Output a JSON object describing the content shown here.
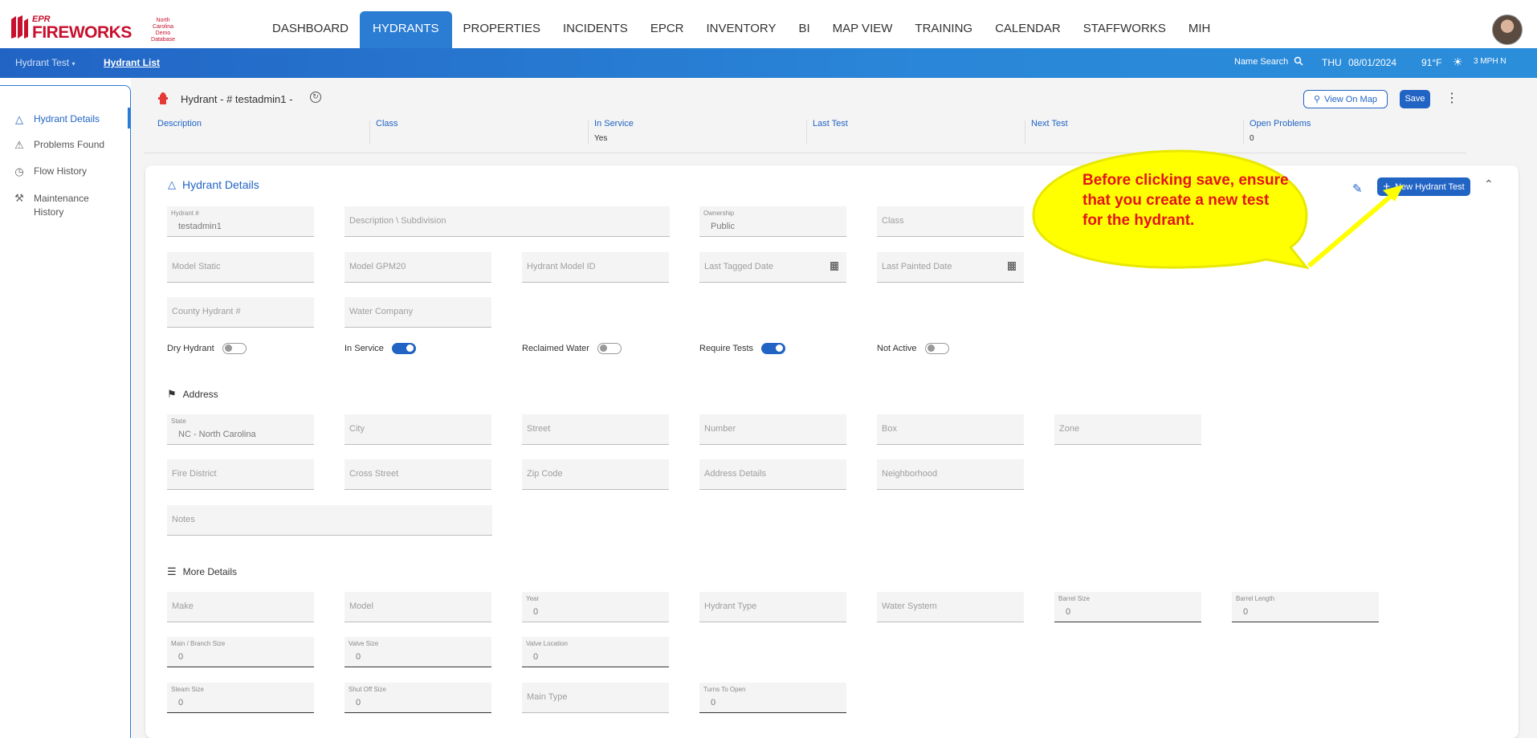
{
  "brand": {
    "epr": "EPR",
    "name": "FIREWORKS",
    "org": "North Carolina Demo Database"
  },
  "nav": [
    {
      "label": "DASHBOARD"
    },
    {
      "label": "HYDRANTS",
      "active": true
    },
    {
      "label": "PROPERTIES"
    },
    {
      "label": "INCIDENTS"
    },
    {
      "label": "EPCR"
    },
    {
      "label": "INVENTORY"
    },
    {
      "label": "BI"
    },
    {
      "label": "MAP VIEW"
    },
    {
      "label": "TRAINING"
    },
    {
      "label": "CALENDAR"
    },
    {
      "label": "STAFFWORKS"
    },
    {
      "label": "MIH"
    }
  ],
  "subbar": {
    "dropdown": "Hydrant Test",
    "list_link": "Hydrant List",
    "name_search": "Name Search",
    "day": "THU",
    "date": "08/01/2024",
    "temp": "91°F",
    "wind": "3 MPH N"
  },
  "sidebar": {
    "items": [
      {
        "label": "Hydrant Details",
        "icon": "hydrant-icon",
        "active": true
      },
      {
        "label": "Problems Found",
        "icon": "warning-icon"
      },
      {
        "label": "Flow History",
        "icon": "gauge-icon"
      },
      {
        "label": "Maintenance History",
        "icon": "tools-icon"
      }
    ]
  },
  "header": {
    "title": "Hydrant - # testadmin1 -",
    "view_on_map": "View On Map",
    "save": "Save"
  },
  "summary": [
    {
      "label": "Description",
      "value": ""
    },
    {
      "label": "Class",
      "value": ""
    },
    {
      "label": "In Service",
      "value": "Yes"
    },
    {
      "label": "Last Test",
      "value": ""
    },
    {
      "label": "Next Test",
      "value": ""
    },
    {
      "label": "Open Problems",
      "value": "0"
    }
  ],
  "card": {
    "title": "Hydrant Details",
    "new_test": "New Hydrant Test"
  },
  "details": {
    "hydrant_no": {
      "label": "Hydrant #",
      "value": "testadmin1"
    },
    "description": "Description \\ Subdivision",
    "ownership": {
      "label": "Ownership",
      "value": "Public"
    },
    "class": "Class",
    "model_static": "Model Static",
    "model_gpm20": "Model GPM20",
    "hydrant_model_id": "Hydrant Model ID",
    "last_tagged": "Last Tagged Date",
    "last_painted": "Last Painted Date",
    "county_hydrant": "County Hydrant #",
    "water_company": "Water Company"
  },
  "toggles": [
    {
      "label": "Dry Hydrant",
      "on": false
    },
    {
      "label": "In Service",
      "on": true
    },
    {
      "label": "Reclaimed Water",
      "on": false
    },
    {
      "label": "Require Tests",
      "on": true
    },
    {
      "label": "Not Active",
      "on": false
    }
  ],
  "address": {
    "title": "Address",
    "state": {
      "label": "State",
      "value": "NC - North Carolina"
    },
    "city": "City",
    "street": "Street",
    "number": "Number",
    "box": "Box",
    "zone": "Zone",
    "fire_district": "Fire District",
    "cross_street": "Cross Street",
    "zip": "Zip Code",
    "address_details": "Address Details",
    "neighborhood": "Neighborhood",
    "notes": "Notes"
  },
  "more": {
    "title": "More Details",
    "make": "Make",
    "model": "Model",
    "year": {
      "label": "Year",
      "value": "0"
    },
    "hydrant_type": "Hydrant Type",
    "water_system": "Water System",
    "barrel_size": {
      "label": "Barrel Size",
      "value": "0"
    },
    "barrel_length": {
      "label": "Barrel Length",
      "value": "0"
    },
    "main_branch": {
      "label": "Main / Branch Size",
      "value": "0"
    },
    "valve_size": {
      "label": "Valve Size",
      "value": "0"
    },
    "valve_location": {
      "label": "Valve Location",
      "value": "0"
    },
    "steam_size": {
      "label": "Steam Size",
      "value": "0"
    },
    "shut_off": {
      "label": "Shut Off Size",
      "value": "0"
    },
    "main_type": "Main Type",
    "turns": {
      "label": "Turns To Open",
      "value": "0"
    }
  },
  "callout": {
    "text": "Before clicking save, ensure that you create a new test for the hydrant."
  },
  "colors": {
    "primary": "#2264c4",
    "brand": "#c8102e",
    "callout_fill": "#ffff00",
    "callout_text": "#e3151a"
  }
}
